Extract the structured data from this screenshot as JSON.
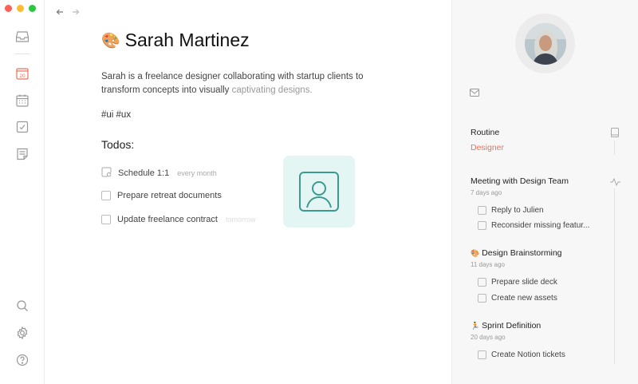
{
  "window": {
    "traffic_colors": [
      "#ff5f57",
      "#febc2e",
      "#28c840"
    ]
  },
  "sidebar": {
    "calendar_day": "20",
    "icons": [
      "inbox-icon",
      "calendar-day-icon",
      "calendar-icon",
      "checkbox-icon",
      "notes-icon",
      "search-icon",
      "gear-icon",
      "help-icon"
    ]
  },
  "page": {
    "emoji": "🎨",
    "title": "Sarah Martinez",
    "description_main": "Sarah is a freelance designer collaborating with startup clients to transform concepts into visually",
    "description_faded": " captivating designs.",
    "tags": "#ui #ux",
    "todos_heading": "Todos:",
    "todos": [
      {
        "label": "Schedule 1:1",
        "meta": "every month",
        "recurring": true
      },
      {
        "label": "Prepare retreat documents",
        "meta": ""
      },
      {
        "label": "Update freelance contract",
        "meta": "tomorrow"
      }
    ]
  },
  "panel": {
    "routine_label": "Routine",
    "routine_value": "Designer",
    "accent_color": "#e8735f",
    "groups": [
      {
        "emoji": "",
        "title": "Meeting with Design Team",
        "when": "7 days ago",
        "tasks": [
          "Reply to Julien",
          "Reconsider missing featur..."
        ]
      },
      {
        "emoji": "🎨",
        "title": "Design Brainstorming",
        "when": "11 days ago",
        "tasks": [
          "Prepare slide deck",
          "Create new assets"
        ]
      },
      {
        "emoji": "🏃",
        "title": "Sprint Definition",
        "when": "20 days ago",
        "tasks": [
          "Create Notion tickets"
        ]
      }
    ]
  }
}
